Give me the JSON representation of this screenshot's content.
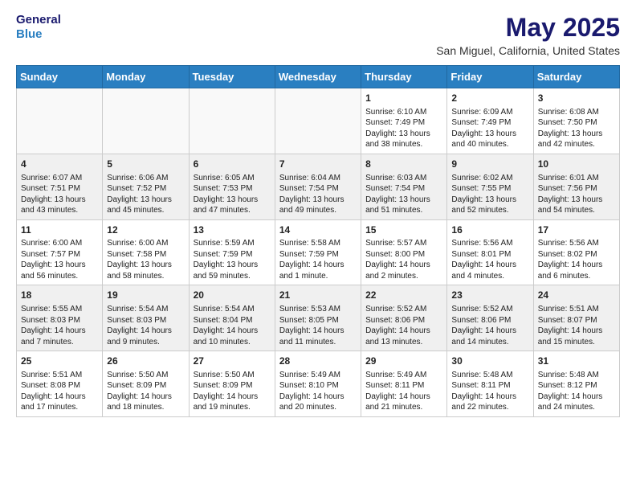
{
  "header": {
    "logo": {
      "line1": "General",
      "line2": "Blue"
    },
    "title": "May 2025",
    "subtitle": "San Miguel, California, United States"
  },
  "weekdays": [
    "Sunday",
    "Monday",
    "Tuesday",
    "Wednesday",
    "Thursday",
    "Friday",
    "Saturday"
  ],
  "weeks": [
    [
      {
        "day": "",
        "data": ""
      },
      {
        "day": "",
        "data": ""
      },
      {
        "day": "",
        "data": ""
      },
      {
        "day": "",
        "data": ""
      },
      {
        "day": "1",
        "data": "Sunrise: 6:10 AM\nSunset: 7:49 PM\nDaylight: 13 hours and 38 minutes."
      },
      {
        "day": "2",
        "data": "Sunrise: 6:09 AM\nSunset: 7:49 PM\nDaylight: 13 hours and 40 minutes."
      },
      {
        "day": "3",
        "data": "Sunrise: 6:08 AM\nSunset: 7:50 PM\nDaylight: 13 hours and 42 minutes."
      }
    ],
    [
      {
        "day": "4",
        "data": "Sunrise: 6:07 AM\nSunset: 7:51 PM\nDaylight: 13 hours and 43 minutes."
      },
      {
        "day": "5",
        "data": "Sunrise: 6:06 AM\nSunset: 7:52 PM\nDaylight: 13 hours and 45 minutes."
      },
      {
        "day": "6",
        "data": "Sunrise: 6:05 AM\nSunset: 7:53 PM\nDaylight: 13 hours and 47 minutes."
      },
      {
        "day": "7",
        "data": "Sunrise: 6:04 AM\nSunset: 7:54 PM\nDaylight: 13 hours and 49 minutes."
      },
      {
        "day": "8",
        "data": "Sunrise: 6:03 AM\nSunset: 7:54 PM\nDaylight: 13 hours and 51 minutes."
      },
      {
        "day": "9",
        "data": "Sunrise: 6:02 AM\nSunset: 7:55 PM\nDaylight: 13 hours and 52 minutes."
      },
      {
        "day": "10",
        "data": "Sunrise: 6:01 AM\nSunset: 7:56 PM\nDaylight: 13 hours and 54 minutes."
      }
    ],
    [
      {
        "day": "11",
        "data": "Sunrise: 6:00 AM\nSunset: 7:57 PM\nDaylight: 13 hours and 56 minutes."
      },
      {
        "day": "12",
        "data": "Sunrise: 6:00 AM\nSunset: 7:58 PM\nDaylight: 13 hours and 58 minutes."
      },
      {
        "day": "13",
        "data": "Sunrise: 5:59 AM\nSunset: 7:59 PM\nDaylight: 13 hours and 59 minutes."
      },
      {
        "day": "14",
        "data": "Sunrise: 5:58 AM\nSunset: 7:59 PM\nDaylight: 14 hours and 1 minute."
      },
      {
        "day": "15",
        "data": "Sunrise: 5:57 AM\nSunset: 8:00 PM\nDaylight: 14 hours and 2 minutes."
      },
      {
        "day": "16",
        "data": "Sunrise: 5:56 AM\nSunset: 8:01 PM\nDaylight: 14 hours and 4 minutes."
      },
      {
        "day": "17",
        "data": "Sunrise: 5:56 AM\nSunset: 8:02 PM\nDaylight: 14 hours and 6 minutes."
      }
    ],
    [
      {
        "day": "18",
        "data": "Sunrise: 5:55 AM\nSunset: 8:03 PM\nDaylight: 14 hours and 7 minutes."
      },
      {
        "day": "19",
        "data": "Sunrise: 5:54 AM\nSunset: 8:03 PM\nDaylight: 14 hours and 9 minutes."
      },
      {
        "day": "20",
        "data": "Sunrise: 5:54 AM\nSunset: 8:04 PM\nDaylight: 14 hours and 10 minutes."
      },
      {
        "day": "21",
        "data": "Sunrise: 5:53 AM\nSunset: 8:05 PM\nDaylight: 14 hours and 11 minutes."
      },
      {
        "day": "22",
        "data": "Sunrise: 5:52 AM\nSunset: 8:06 PM\nDaylight: 14 hours and 13 minutes."
      },
      {
        "day": "23",
        "data": "Sunrise: 5:52 AM\nSunset: 8:06 PM\nDaylight: 14 hours and 14 minutes."
      },
      {
        "day": "24",
        "data": "Sunrise: 5:51 AM\nSunset: 8:07 PM\nDaylight: 14 hours and 15 minutes."
      }
    ],
    [
      {
        "day": "25",
        "data": "Sunrise: 5:51 AM\nSunset: 8:08 PM\nDaylight: 14 hours and 17 minutes."
      },
      {
        "day": "26",
        "data": "Sunrise: 5:50 AM\nSunset: 8:09 PM\nDaylight: 14 hours and 18 minutes."
      },
      {
        "day": "27",
        "data": "Sunrise: 5:50 AM\nSunset: 8:09 PM\nDaylight: 14 hours and 19 minutes."
      },
      {
        "day": "28",
        "data": "Sunrise: 5:49 AM\nSunset: 8:10 PM\nDaylight: 14 hours and 20 minutes."
      },
      {
        "day": "29",
        "data": "Sunrise: 5:49 AM\nSunset: 8:11 PM\nDaylight: 14 hours and 21 minutes."
      },
      {
        "day": "30",
        "data": "Sunrise: 5:48 AM\nSunset: 8:11 PM\nDaylight: 14 hours and 22 minutes."
      },
      {
        "day": "31",
        "data": "Sunrise: 5:48 AM\nSunset: 8:12 PM\nDaylight: 14 hours and 24 minutes."
      }
    ]
  ]
}
